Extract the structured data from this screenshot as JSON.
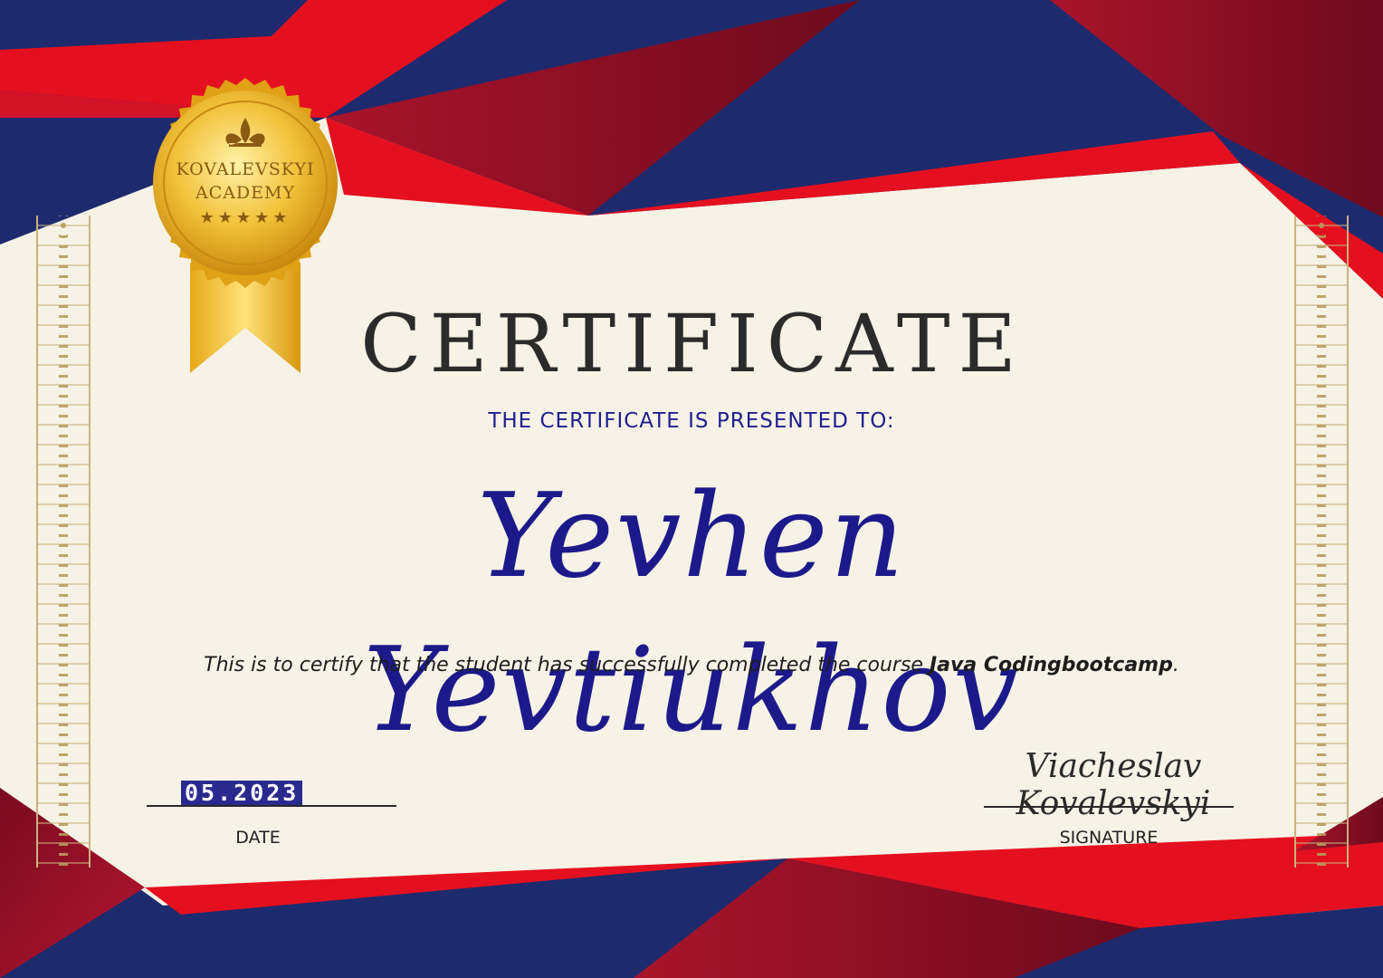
{
  "seal": {
    "line1": "KOVALEVSKYI",
    "line2": "ACADEMY",
    "stars": "★★★★★"
  },
  "certificate": {
    "title": "CERTIFICATE",
    "presented_to": "THE CERTIFICATE IS PRESENTED TO:",
    "recipient": "Yevhen Yevtiukhov",
    "certify_text": "This is to certify that the student has successfully completed the course ",
    "course_name": "Java Codingbootcamp",
    "certify_end": "."
  },
  "footer": {
    "date_value": "05.2023",
    "date_label": "DATE",
    "signature_text": "Viacheslav Kovalevskyi",
    "signature_label": "SIGNATURE"
  },
  "colors": {
    "navy": "#1e2a6e",
    "red": "#e4101f",
    "crimson": "#8e0a25",
    "gold": "#d9a520",
    "paper": "#f6f2e6"
  }
}
